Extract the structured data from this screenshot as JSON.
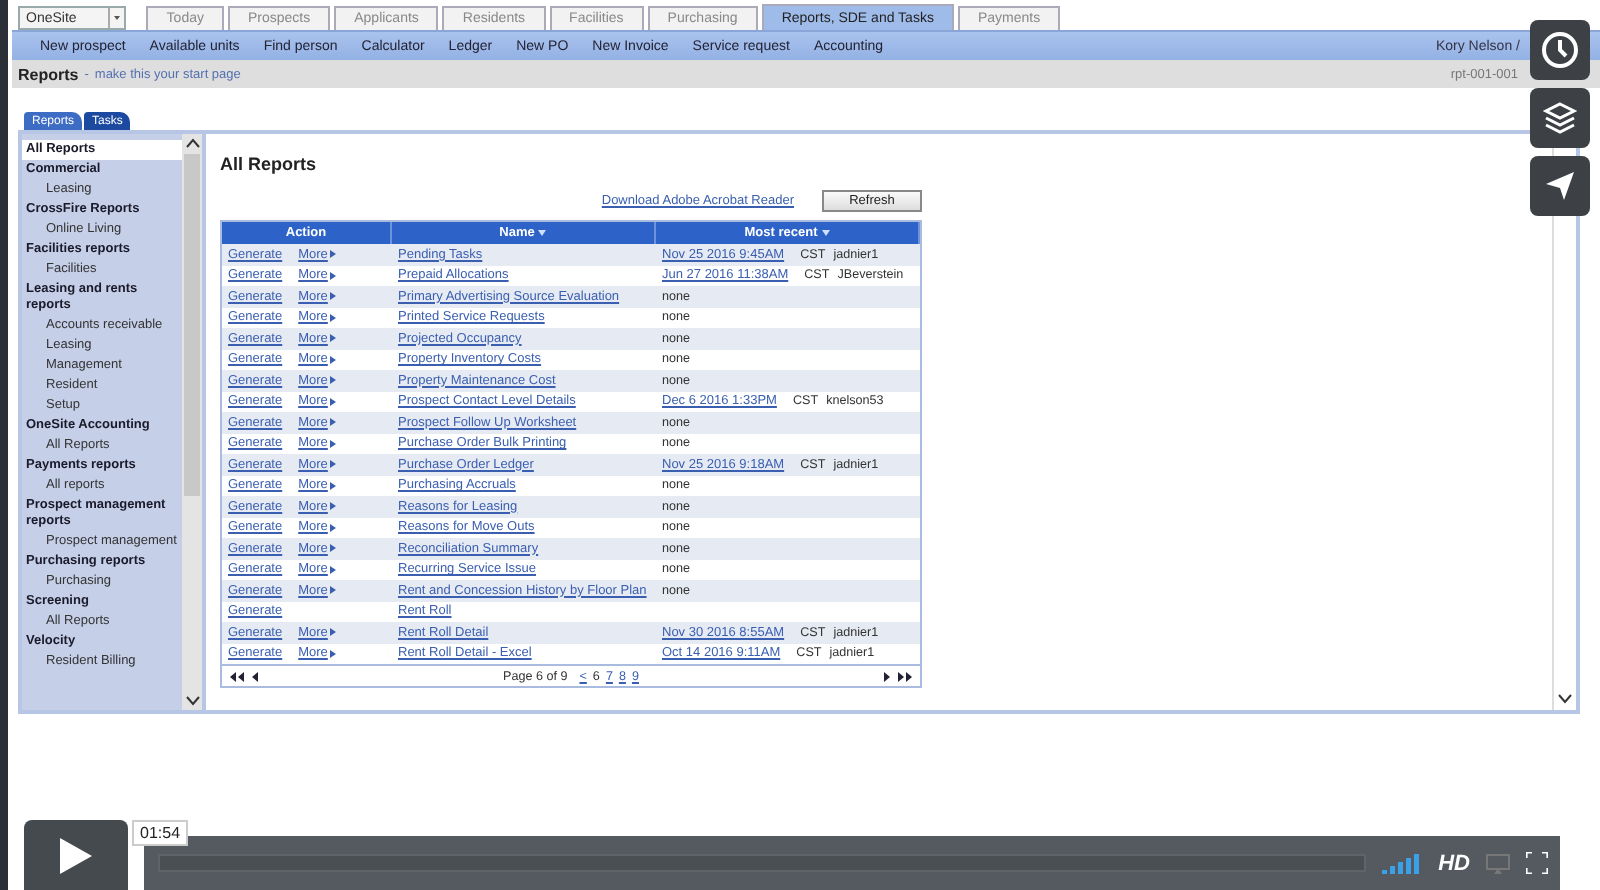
{
  "top": {
    "product_menu": "OneSite",
    "tabs": [
      {
        "label": "Today",
        "selected": false
      },
      {
        "label": "Prospects",
        "selected": false
      },
      {
        "label": "Applicants",
        "selected": false
      },
      {
        "label": "Residents",
        "selected": false
      },
      {
        "label": "Facilities",
        "selected": false
      },
      {
        "label": "Purchasing",
        "selected": false
      },
      {
        "label": "Reports, SDE and Tasks",
        "selected": true
      },
      {
        "label": "Payments",
        "selected": false
      }
    ],
    "nav": [
      "New prospect",
      "Available units",
      "Find person",
      "Calculator",
      "Ledger",
      "New PO",
      "New Invoice",
      "Service request",
      "Accounting"
    ],
    "user": "Kory Nelson",
    "user_separator": "/"
  },
  "title_bar": {
    "title": "Reports",
    "separator": "-",
    "link": "make this your start page",
    "code": "rpt-001-001"
  },
  "panel_tabs": [
    {
      "label": "Reports",
      "selected": true
    },
    {
      "label": "Tasks",
      "selected": false
    }
  ],
  "sidebar": [
    {
      "label": "All Reports",
      "selected": true
    },
    {
      "label": "Commercial",
      "selected": false,
      "children": [
        {
          "label": "Leasing"
        }
      ]
    },
    {
      "label": "CrossFire Reports",
      "selected": false,
      "children": [
        {
          "label": "Online Living"
        }
      ]
    },
    {
      "label": "Facilities reports",
      "selected": false,
      "children": [
        {
          "label": "Facilities"
        }
      ]
    },
    {
      "label": "Leasing and rents reports",
      "selected": false,
      "children": [
        {
          "label": "Accounts receivable"
        },
        {
          "label": "Leasing"
        },
        {
          "label": "Management"
        },
        {
          "label": "Resident"
        },
        {
          "label": "Setup"
        }
      ]
    },
    {
      "label": "OneSite Accounting",
      "selected": false,
      "children": [
        {
          "label": "All Reports"
        }
      ]
    },
    {
      "label": "Payments reports",
      "selected": false,
      "children": [
        {
          "label": "All reports"
        }
      ]
    },
    {
      "label": "Prospect management reports",
      "selected": false,
      "children": [
        {
          "label": "Prospect management"
        }
      ]
    },
    {
      "label": "Purchasing reports",
      "selected": false,
      "children": [
        {
          "label": "Purchasing"
        }
      ]
    },
    {
      "label": "Screening",
      "selected": false,
      "children": [
        {
          "label": "All Reports"
        }
      ]
    },
    {
      "label": "Velocity",
      "selected": false,
      "children": [
        {
          "label": "Resident Billing"
        }
      ]
    }
  ],
  "content": {
    "heading": "All Reports",
    "download_link": "Download Adobe Acrobat Reader",
    "refresh_button": "Refresh",
    "columns": [
      {
        "label": "Action",
        "sorted": false
      },
      {
        "label": "Name",
        "sorted": true
      },
      {
        "label": "Most recent",
        "sorted": true
      }
    ],
    "rows": [
      {
        "actions": [
          {
            "label": "Generate",
            "kind": "link"
          },
          {
            "label": "More",
            "kind": "menu"
          }
        ],
        "name": "Pending Tasks",
        "recent": {
          "date": "Nov 25 2016 9:45AM",
          "tz": "CST",
          "user": "jadnier1"
        }
      },
      {
        "actions": [
          {
            "label": "Generate",
            "kind": "link"
          },
          {
            "label": "More",
            "kind": "menu"
          }
        ],
        "name": "Prepaid Allocations",
        "recent": {
          "date": "Jun 27 2016 11:38AM",
          "tz": "CST",
          "user": "JBeverstein"
        }
      },
      {
        "actions": [
          {
            "label": "Generate",
            "kind": "link"
          },
          {
            "label": "More",
            "kind": "menu"
          }
        ],
        "name": "Primary Advertising Source Evaluation",
        "recent_text": "none"
      },
      {
        "actions": [
          {
            "label": "Generate",
            "kind": "link"
          },
          {
            "label": "More",
            "kind": "menu"
          }
        ],
        "name": "Printed Service Requests",
        "recent_text": "none"
      },
      {
        "actions": [
          {
            "label": "Generate",
            "kind": "link"
          },
          {
            "label": "More",
            "kind": "menu"
          }
        ],
        "name": "Projected Occupancy",
        "recent_text": "none"
      },
      {
        "actions": [
          {
            "label": "Generate",
            "kind": "link"
          },
          {
            "label": "More",
            "kind": "menu"
          }
        ],
        "name": "Property Inventory Costs",
        "recent_text": "none"
      },
      {
        "actions": [
          {
            "label": "Generate",
            "kind": "link"
          },
          {
            "label": "More",
            "kind": "menu"
          }
        ],
        "name": "Property Maintenance Cost",
        "recent_text": "none"
      },
      {
        "actions": [
          {
            "label": "Generate",
            "kind": "link"
          },
          {
            "label": "More",
            "kind": "menu"
          }
        ],
        "name": "Prospect Contact Level Details",
        "recent": {
          "date": "Dec 6 2016 1:33PM",
          "tz": "CST",
          "user": "knelson53"
        }
      },
      {
        "actions": [
          {
            "label": "Generate",
            "kind": "link"
          },
          {
            "label": "More",
            "kind": "menu"
          }
        ],
        "name": "Prospect Follow Up Worksheet",
        "recent_text": "none"
      },
      {
        "actions": [
          {
            "label": "Generate",
            "kind": "link"
          },
          {
            "label": "More",
            "kind": "menu"
          }
        ],
        "name": "Purchase Order Bulk Printing",
        "recent_text": "none"
      },
      {
        "actions": [
          {
            "label": "Generate",
            "kind": "link"
          },
          {
            "label": "More",
            "kind": "menu"
          }
        ],
        "name": "Purchase Order Ledger",
        "recent": {
          "date": "Nov 25 2016 9:18AM",
          "tz": "CST",
          "user": "jadnier1"
        }
      },
      {
        "actions": [
          {
            "label": "Generate",
            "kind": "link"
          },
          {
            "label": "More",
            "kind": "menu"
          }
        ],
        "name": "Purchasing Accruals",
        "recent_text": "none"
      },
      {
        "actions": [
          {
            "label": "Generate",
            "kind": "link"
          },
          {
            "label": "More",
            "kind": "menu"
          }
        ],
        "name": "Reasons for Leasing",
        "recent_text": "none"
      },
      {
        "actions": [
          {
            "label": "Generate",
            "kind": "link"
          },
          {
            "label": "More",
            "kind": "menu"
          }
        ],
        "name": "Reasons for Move Outs",
        "recent_text": "none"
      },
      {
        "actions": [
          {
            "label": "Generate",
            "kind": "link"
          },
          {
            "label": "More",
            "kind": "menu"
          }
        ],
        "name": "Reconciliation Summary",
        "recent_text": "none"
      },
      {
        "actions": [
          {
            "label": "Generate",
            "kind": "link"
          },
          {
            "label": "More",
            "kind": "menu"
          }
        ],
        "name": "Recurring Service Issue",
        "recent_text": "none"
      },
      {
        "actions": [
          {
            "label": "Generate",
            "kind": "link"
          },
          {
            "label": "More",
            "kind": "menu"
          }
        ],
        "name": "Rent and Concession History by Floor Plan",
        "recent_text": "none"
      },
      {
        "actions": [
          {
            "label": "Generate",
            "kind": "link"
          }
        ],
        "name": "Rent Roll"
      },
      {
        "actions": [
          {
            "label": "Generate",
            "kind": "link"
          },
          {
            "label": "More",
            "kind": "menu"
          }
        ],
        "name": "Rent Roll Detail",
        "recent": {
          "date": "Nov 30 2016 8:55AM",
          "tz": "CST",
          "user": "jadnier1"
        }
      },
      {
        "actions": [
          {
            "label": "Generate",
            "kind": "link"
          },
          {
            "label": "More",
            "kind": "menu"
          }
        ],
        "name": "Rent Roll Detail - Excel",
        "recent": {
          "date": "Oct 14 2016 9:11AM",
          "tz": "CST",
          "user": "jadnier1"
        }
      }
    ],
    "pager": {
      "label": "Page 6 of 9",
      "pages": [
        {
          "label": "<",
          "selected": false
        },
        {
          "label": "6",
          "selected": true
        },
        {
          "label": "7",
          "selected": false
        },
        {
          "label": "8",
          "selected": false
        },
        {
          "label": "9",
          "selected": false
        }
      ]
    }
  },
  "player": {
    "time": "01:54",
    "quality": "HD"
  }
}
